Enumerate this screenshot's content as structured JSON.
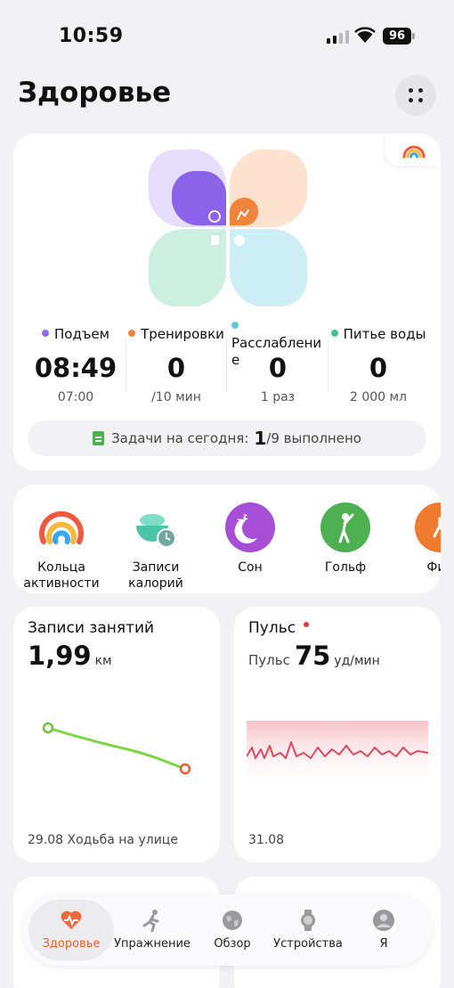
{
  "status_bar": {
    "time": "10:59",
    "battery": "96"
  },
  "header": {
    "title": "Здоровье"
  },
  "summary": {
    "metrics": [
      {
        "label": "Подъем",
        "value": "08:49",
        "sub": "07:00",
        "color": "#8b6fe8"
      },
      {
        "label": "Тренировки",
        "value": "0",
        "sub": "/10 мин",
        "color": "#f0843c"
      },
      {
        "label": "Расслаблени е",
        "value": "0",
        "sub": "1 раз",
        "color": "#5ec8d6"
      },
      {
        "label": "Питье воды",
        "value": "0",
        "sub": "2 000 мл",
        "color": "#46c08e"
      }
    ],
    "tasks": {
      "prefix": "Задачи на сегодня:",
      "done": "1",
      "suffix": "/9 выполнено"
    }
  },
  "shortcuts": [
    {
      "label": "Кольца активности",
      "icon": "activity-rings-icon"
    },
    {
      "label": "Записи калорий",
      "icon": "calorie-bowl-icon"
    },
    {
      "label": "Сон",
      "icon": "sleep-moon-icon",
      "color": "#a64fd6"
    },
    {
      "label": "Гольф",
      "icon": "golf-icon",
      "color": "#4cb050"
    },
    {
      "label": "Фит",
      "icon": "fitness-icon",
      "color": "#f07a30"
    }
  ],
  "activity_card": {
    "title": "Записи занятий",
    "value": "1,99",
    "unit": "км",
    "footer": "29.08 Ходьба на улице"
  },
  "pulse_card": {
    "title": "Пульс",
    "prefix": "Пульс",
    "value": "75",
    "unit": "уд/мин",
    "footer": "31.08"
  },
  "tabbar": {
    "tabs": [
      {
        "label": "Здоровье",
        "icon": "heart-pulse-icon",
        "active": true
      },
      {
        "label": "Упражнение",
        "icon": "running-icon"
      },
      {
        "label": "Обзор",
        "icon": "globe-icon"
      },
      {
        "label": "Устройства",
        "icon": "watch-icon"
      },
      {
        "label": "Я",
        "icon": "profile-icon"
      }
    ]
  },
  "colors": {
    "accent": "#e8602a",
    "activity_line": "#7dd646",
    "pulse_line": "#e04a5e"
  }
}
